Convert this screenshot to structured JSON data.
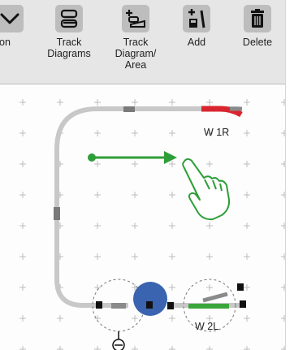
{
  "toolbar": {
    "items": [
      {
        "label": "on"
      },
      {
        "label": "Track\nDiagrams"
      },
      {
        "label": "Track\nDiagram/\nArea"
      },
      {
        "label": "Add"
      },
      {
        "label": "Delete"
      }
    ]
  },
  "canvas": {
    "turnouts": [
      {
        "label": "W 1R"
      },
      {
        "label": "W 2L"
      }
    ]
  },
  "colors": {
    "toolbar_bg": "#e6e6e6",
    "icon_bg": "#bdbdbd",
    "track": "#c8c8c8",
    "active_turnout": "#d9252f",
    "straight_turnout": "#3aa63a",
    "selection": "#3a64b0",
    "gesture": "#2e9e38"
  },
  "icons": [
    "chevron-down-icon",
    "track-diagrams-icon",
    "track-diagram-area-icon",
    "add-icon",
    "delete-icon",
    "tap-gesture-hand-icon",
    "drag-arrow-icon",
    "signal-icon"
  ]
}
